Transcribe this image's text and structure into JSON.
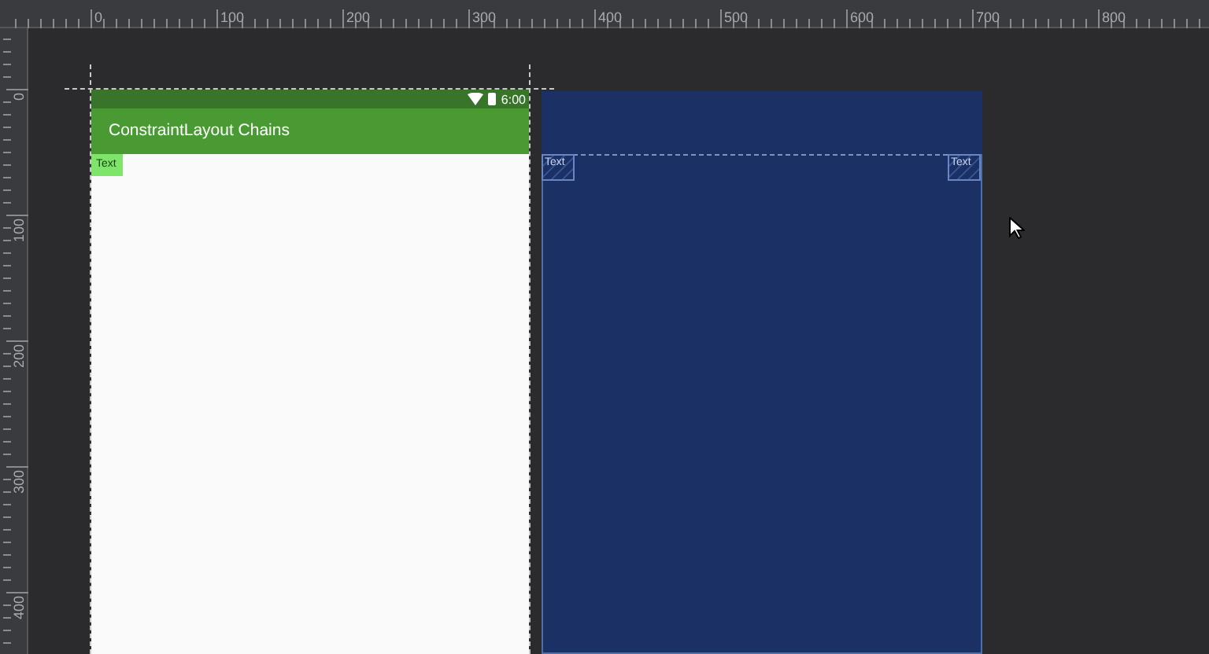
{
  "ruler_top": {
    "labels": [
      "0",
      "100",
      "200",
      "300",
      "400",
      "500",
      "600",
      "700",
      "800"
    ]
  },
  "ruler_left": {
    "labels": [
      "0",
      "100",
      "200",
      "300",
      "400"
    ]
  },
  "design": {
    "status_bar": {
      "time": "6:00"
    },
    "app_bar": {
      "title": "ConstraintLayout Chains"
    },
    "text_views": [
      {
        "text": "Text"
      }
    ]
  },
  "blueprint": {
    "text_views": [
      {
        "text": "Text"
      },
      {
        "text": "Text"
      }
    ]
  }
}
